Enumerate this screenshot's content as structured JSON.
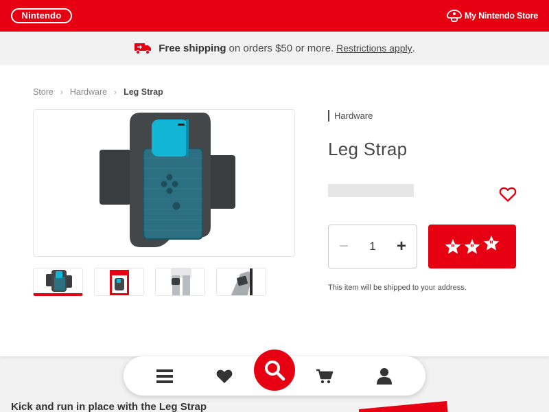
{
  "header": {
    "logo_text": "Nintendo",
    "store_link": "My Nintendo Store",
    "brand_color": "#e60012"
  },
  "shipping_banner": {
    "bold_text": "Free shipping",
    "text": "on orders $50 or more.",
    "link": "Restrictions apply",
    "trailing": "."
  },
  "breadcrumb": {
    "items": [
      "Store",
      "Hardware",
      "Leg Strap"
    ]
  },
  "product": {
    "category": "Hardware",
    "title": "Leg Strap",
    "quantity": "1",
    "shipping_note": "This item will be shipped to your address."
  },
  "icons": {
    "truck": "truck-icon",
    "heart": "heart-icon",
    "mario_stars": "star-icon"
  },
  "bottom_nav": {
    "items": [
      "menu-icon",
      "wishlist-icon",
      "search-icon",
      "cart-icon",
      "account-icon"
    ]
  },
  "section": {
    "heading": "Kick and run in place with the Leg Strap"
  }
}
